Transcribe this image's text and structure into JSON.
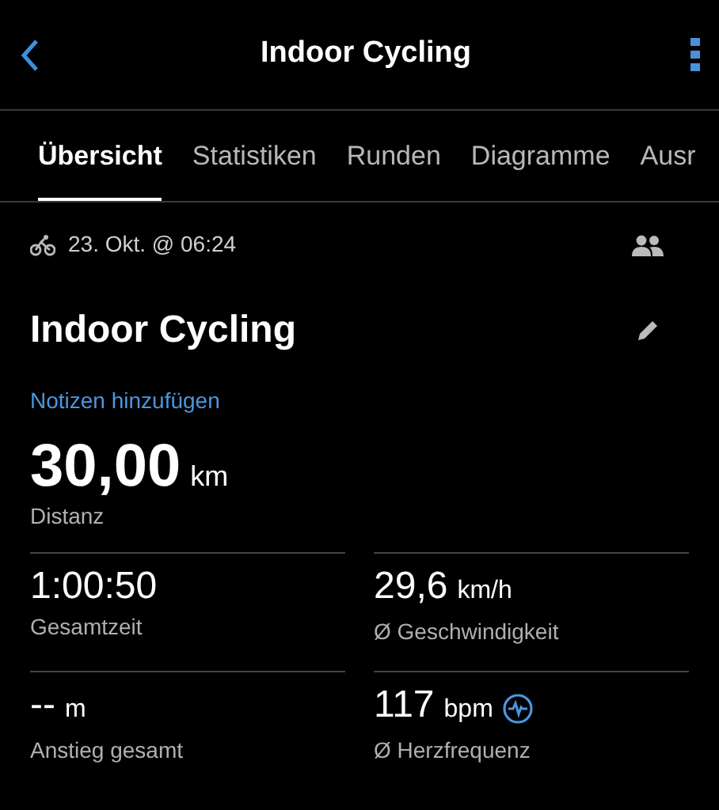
{
  "header": {
    "title": "Indoor Cycling"
  },
  "tabs": [
    {
      "label": "Übersicht",
      "selected": true
    },
    {
      "label": "Statistiken",
      "selected": false
    },
    {
      "label": "Runden",
      "selected": false
    },
    {
      "label": "Diagramme",
      "selected": false
    },
    {
      "label": "Ausr",
      "selected": false
    }
  ],
  "activity": {
    "date": "23. Okt. @ 06:24",
    "name": "Indoor Cycling",
    "notes_link": "Notizen hinzufügen"
  },
  "distance": {
    "value": "30,00",
    "unit": "km",
    "label": "Distanz"
  },
  "stats": [
    {
      "kind": "plain",
      "value": "1:00:50",
      "label": "Gesamtzeit"
    },
    {
      "kind": "plain",
      "value": "29,6",
      "unit": "km/h",
      "label": "Ø Geschwindigkeit"
    },
    {
      "kind": "plain",
      "value": "--",
      "unit": "m",
      "label": "Anstieg gesamt"
    },
    {
      "kind": "heart_rate",
      "value": "117",
      "unit": "bpm",
      "label": "Ø Herzfrequenz"
    }
  ]
}
